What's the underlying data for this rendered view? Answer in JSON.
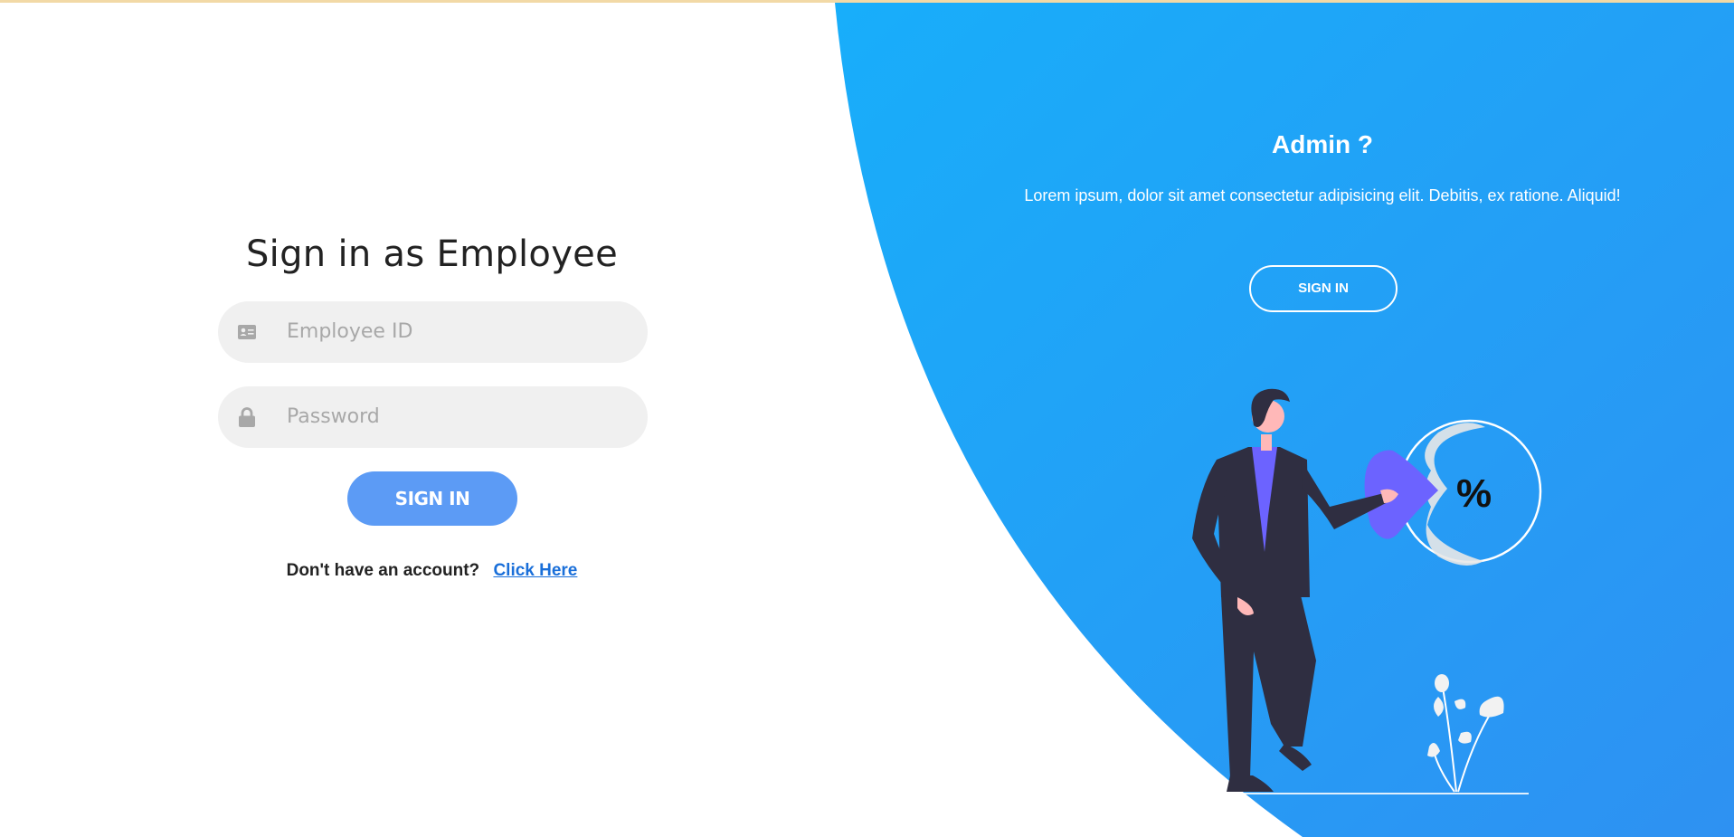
{
  "login": {
    "title": "Sign in as Employee",
    "employee_id_placeholder": "Employee ID",
    "password_placeholder": "Password",
    "signin_label": "SIGN IN",
    "account_prompt": "Don't have an account?",
    "account_link": "Click Here"
  },
  "admin_panel": {
    "title": "Admin ?",
    "description": "Lorem ipsum, dolor sit amet consectetur adipisicing elit. Debitis, ex ratione. Aliquid!",
    "signin_label": "SIGN IN"
  },
  "illustration": {
    "badge_text": "%"
  },
  "icons": {
    "employee_id": "id-card-icon",
    "password": "lock-icon"
  },
  "colors": {
    "gradient_start": "#1aaaf8",
    "gradient_end": "#2d93f2",
    "primary_button": "#5c9bf5",
    "link": "#1a6fd9",
    "input_bg": "#f0f0f0",
    "figure_dark": "#2f2e41",
    "accent_purple": "#6c63ff"
  }
}
